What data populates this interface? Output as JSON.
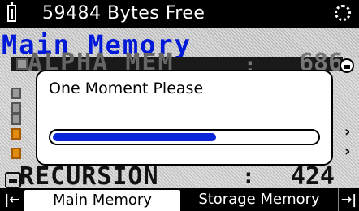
{
  "status_bar": {
    "free_memory": "59484 Bytes Free",
    "battery_icon": "battery-icon",
    "busy_icon": "busy-spinner-icon"
  },
  "title": "Main Memory",
  "list": {
    "top_item": {
      "name": "ALPHA MEM",
      "separator": ":",
      "value": "686"
    },
    "bottom_item": {
      "name": "RECURSION",
      "separator": ":",
      "value": "424"
    }
  },
  "dialog": {
    "message": "One Moment Please",
    "progress_fraction": 0.62
  },
  "tabs": {
    "first_label": "|←",
    "main_memory": "Main Memory",
    "storage_memory": "Storage Memory",
    "last_label": "→|"
  },
  "colors": {
    "title": "#0018d8",
    "progress": "#0b25d8",
    "folder_icon": "#e38a10"
  }
}
